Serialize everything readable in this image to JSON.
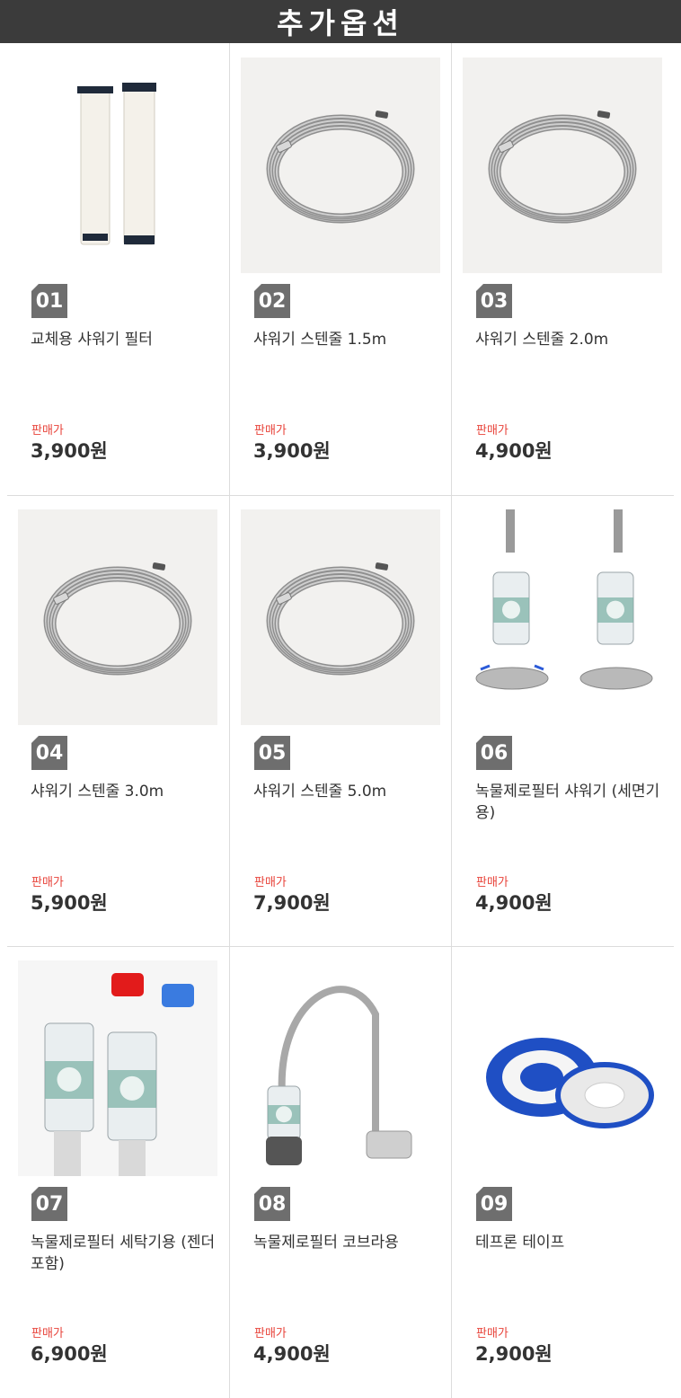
{
  "header": {
    "title": "추가옵션"
  },
  "labels": {
    "price_label": "판매가"
  },
  "colors": {
    "header_bg": "#3b3b3b",
    "badge_bg": "#6e6e6e",
    "price_label": "#e8433a"
  },
  "products": [
    {
      "number": "01",
      "name": "교체용 샤워기 필터",
      "price": "3,900원",
      "image": "filter-cartridges-image"
    },
    {
      "number": "02",
      "name": "샤워기 스텐줄 1.5m",
      "price": "3,900원",
      "image": "shower-hose-image"
    },
    {
      "number": "03",
      "name": "샤워기 스텐줄 2.0m",
      "price": "4,900원",
      "image": "shower-hose-image"
    },
    {
      "number": "04",
      "name": "샤워기 스텐줄 3.0m",
      "price": "5,900원",
      "image": "shower-hose-image"
    },
    {
      "number": "05",
      "name": "샤워기 스텐줄 5.0m",
      "price": "7,900원",
      "image": "shower-hose-image"
    },
    {
      "number": "06",
      "name": "녹물제로필터 샤워기 (세면기용)",
      "price": "4,900원",
      "image": "washbasin-filter-image"
    },
    {
      "number": "07",
      "name": "녹물제로필터 세탁기용 (젠더포함)",
      "price": "6,900원",
      "image": "washing-machine-filter-image"
    },
    {
      "number": "08",
      "name": "녹물제로필터 코브라용",
      "price": "4,900원",
      "image": "cobra-faucet-filter-image"
    },
    {
      "number": "09",
      "name": "테프론 테이프",
      "price": "2,900원",
      "image": "teflon-tape-image"
    }
  ]
}
